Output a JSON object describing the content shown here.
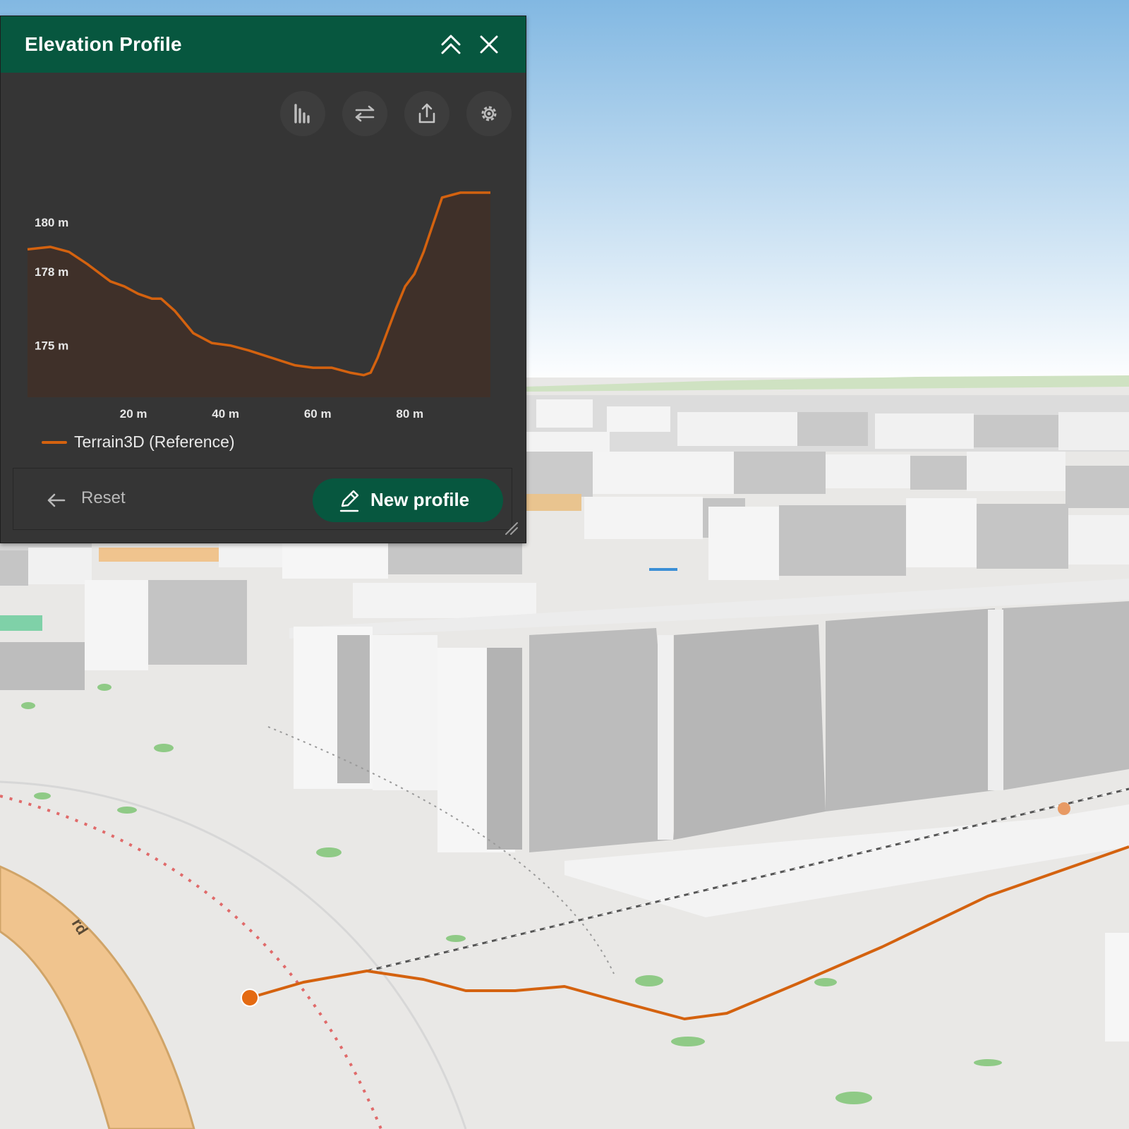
{
  "panel": {
    "title": "Elevation Profile",
    "buttons": {
      "collapse": "chevrons-up-icon",
      "close": "close-icon",
      "statistics": "bar-chart-icon",
      "flip": "swap-arrows-icon",
      "export": "share-upload-icon",
      "settings": "gear-icon"
    },
    "footer": {
      "reset_label": "Reset",
      "new_profile_label": "New profile"
    }
  },
  "chart_data": {
    "type": "area",
    "title": "",
    "xlabel": "",
    "ylabel": "",
    "x_ticks": [
      "20 m",
      "40 m",
      "60 m",
      "80 m"
    ],
    "y_ticks": [
      "180 m",
      "178 m",
      "175 m"
    ],
    "xlim": [
      -3,
      97.5
    ],
    "ylim": [
      172.9,
      181.2
    ],
    "grid": false,
    "legend_position": "bottom-left",
    "series": [
      {
        "name": "Terrain3D (Reference)",
        "color": "#d4620f",
        "x": [
          -3,
          2,
          6,
          10,
          15,
          18,
          21,
          24,
          26,
          29,
          33,
          37,
          41,
          45,
          50,
          55,
          59,
          63,
          67,
          70,
          71.5,
          73,
          75,
          77,
          79,
          81,
          83,
          85,
          87,
          89,
          91,
          93,
          95.5,
          97.5
        ],
        "y": [
          178.9,
          179.0,
          178.8,
          178.3,
          177.6,
          177.4,
          177.1,
          176.9,
          176.9,
          176.4,
          175.5,
          175.1,
          175.0,
          174.8,
          174.5,
          174.2,
          174.1,
          174.1,
          173.9,
          173.8,
          173.9,
          174.5,
          175.5,
          176.5,
          177.4,
          177.9,
          178.8,
          179.9,
          181.0,
          181.1,
          181.2,
          181.2,
          181.2,
          181.2
        ]
      }
    ]
  },
  "scene": {
    "sky_top": "#82b8e2",
    "sky_bottom": "#ffffff",
    "ground": "#e9e8e6",
    "road": "#f0c48e",
    "profile_line": "#d4620f",
    "road_label": "rd"
  }
}
